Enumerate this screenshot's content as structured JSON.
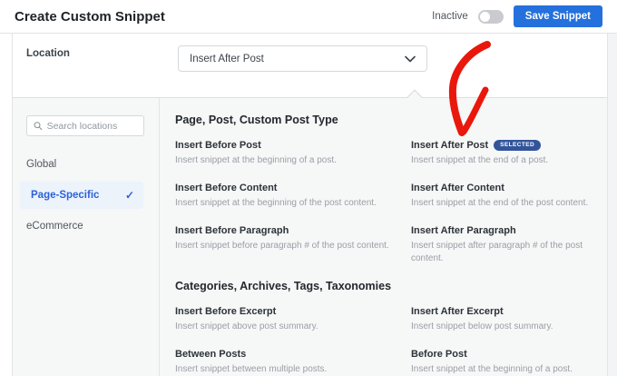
{
  "header": {
    "title": "Create Custom Snippet",
    "status_label": "Inactive",
    "toggle_state": "off",
    "save_label": "Save Snippet"
  },
  "location_bar": {
    "label": "Location",
    "value": "Insert After Post",
    "chevron_icon": "chevron-down"
  },
  "sidebar": {
    "search_placeholder": "Search locations",
    "search_icon": "magnifier",
    "check_icon": "✓",
    "items": [
      {
        "label": "Global",
        "active": false
      },
      {
        "label": "Page-Specific",
        "active": true
      },
      {
        "label": "eCommerce",
        "active": false
      }
    ]
  },
  "sections": [
    {
      "heading": "Page, Post, Custom Post Type",
      "options": [
        {
          "title": "Insert Before Post",
          "desc": "Insert snippet at the beginning of a post."
        },
        {
          "title": "Insert After Post",
          "desc": "Insert snippet at the end of a post.",
          "badge": "SELECTED"
        },
        {
          "title": "Insert Before Content",
          "desc": "Insert snippet at the beginning of the post content."
        },
        {
          "title": "Insert After Content",
          "desc": "Insert snippet at the end of the post content."
        },
        {
          "title": "Insert Before Paragraph",
          "desc": "Insert snippet before paragraph # of the post content."
        },
        {
          "title": "Insert After Paragraph",
          "desc": "Insert snippet after paragraph # of the post content."
        }
      ]
    },
    {
      "heading": "Categories, Archives, Tags, Taxonomies",
      "options": [
        {
          "title": "Insert Before Excerpt",
          "desc": "Insert snippet above post summary."
        },
        {
          "title": "Insert After Excerpt",
          "desc": "Insert snippet below post summary."
        },
        {
          "title": "Between Posts",
          "desc": "Insert snippet between multiple posts."
        },
        {
          "title": "Before Post",
          "desc": "Insert snippet at the beginning of a post."
        }
      ]
    }
  ],
  "colors": {
    "button_blue": "#2470dc",
    "badge_blue": "#32549b",
    "active_item_blue": "#2b62d9",
    "active_item_bg": "#edf3fb",
    "panel_bg": "#f6f7f7",
    "arrow_red": "#e9170c"
  }
}
